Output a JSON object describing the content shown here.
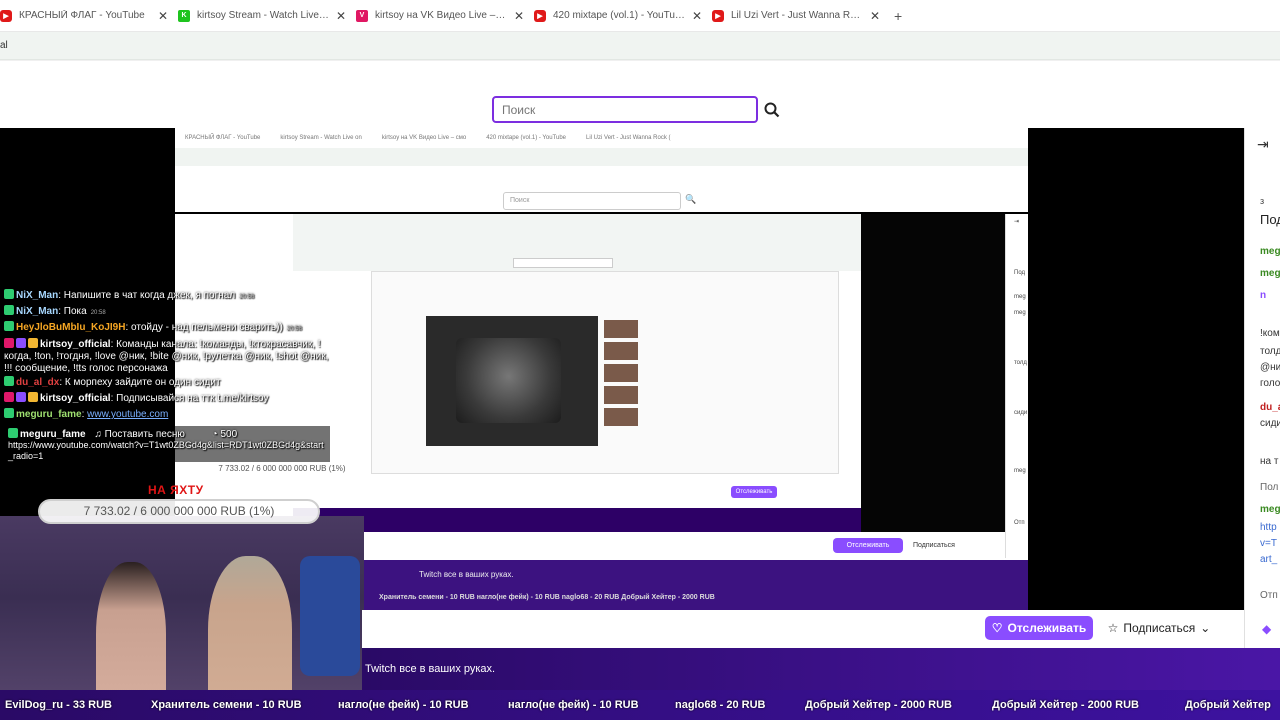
{
  "tabs": [
    {
      "title": "КРАСНЫЙ ФЛАГ - YouTube",
      "favicon": "youtube-icon"
    },
    {
      "title": "kirtsoy Stream - Watch Live on",
      "favicon": "twitch-k-icon"
    },
    {
      "title": "kirtsoy на VK Видео Live – смо",
      "favicon": "vk-video-icon"
    },
    {
      "title": "420 mixtape (vol.1) - YouTube",
      "favicon": "youtube-icon"
    },
    {
      "title": "Lil Uzi Vert - Just Wanna Rock (",
      "favicon": "youtube-icon"
    }
  ],
  "search": {
    "placeholder": "Поиск"
  },
  "nested": {
    "tabs": [
      "КРАСНЫЙ ФЛАГ - YouTube",
      "kirtsoy Stream - Watch Live on",
      "kirtsoy на VK Видео Live – смо",
      "420 mixtape (vol.1) - YouTube",
      "Lil Uzi Vert - Just Wanna Rock ("
    ],
    "search_placeholder": "Поиск",
    "follow_label": "Отслеживать",
    "subscribe_label": "Подписаться",
    "banner_text": "Twitch все в ваших руках.",
    "ticker_text": "Хранитель семени - 10 RUB      нагло(не фейк) - 10 RUB      naglo68 - 20 RUB      Добрый Хейтер - 2000 RUB",
    "inner_follow": "Отслеживать"
  },
  "chat": [
    {
      "name": "NiX_Man",
      "text": "Напишите в чат когда джек, я погнал",
      "time": "20:58",
      "color": "#a8d8ff"
    },
    {
      "name": "NiX_Man",
      "text": "Пока",
      "time": "20:58",
      "color": "#a8d8ff"
    },
    {
      "name": "HeyJloBuMbIu_KoJI9H",
      "text": "отойду - над пельмени сварить))",
      "time": "20:58",
      "color": "#f5a623"
    },
    {
      "name": "kirtsoy_official",
      "text": "Команды канала: !команды, !ктокрасавчик, !когда, !ton, !тогдня, !love @ник, !bite @ник, !рулетка @ник, !shot @ник, !!! сообщение, !tts голос персонажа",
      "time": "",
      "color": "#ffffff"
    },
    {
      "name": "du_al_dx",
      "text": "К морпеху зайдите он один сидит",
      "time": "",
      "color": "#e04040"
    },
    {
      "name": "kirtsoy_official",
      "text": "Подписывайся на ттк t.me/kirtsoy",
      "time": "",
      "color": "#ffffff"
    },
    {
      "name": "meguru_fame",
      "text": "www.youtube.com",
      "time": "",
      "color": "#9fe070"
    },
    {
      "name": "meguru_fame",
      "text": "Поставить песню",
      "time": "",
      "color": "#ffffff"
    }
  ],
  "tts": {
    "points": "500",
    "url": "https://www.youtube.com/watch?v=T1wt0ZBGd4g&list=RDT1wt0ZBGd4g&start_radio=1",
    "small_goal": "7 733.02 / 6 000 000 000 RUB (1%)"
  },
  "goal": {
    "title": "НА ЯХТУ",
    "text": "7 733.02 / 6 000 000 000 RUB (1%)",
    "progress": 0.01
  },
  "channel": {
    "follow_label": "Отслеживать",
    "subscribe_label": "Подписаться",
    "banner_text": "Twitch все в ваших руках."
  },
  "ticker": [
    "EvilDog_ru - 33 RUB",
    "Хранитель семени - 10 RUB",
    "нагло(не фейк) - 10 RUB",
    "нагло(не фейк) - 10 RUB",
    "naglo68 - 20 RUB",
    "Добрый Хейтер - 2000 RUB",
    "Добрый Хейтер - 2000 RUB",
    "Добрый Хейтер"
  ],
  "right_panel": [
    "з",
    "Под",
    "meg",
    "meg",
    "n",
    "!ком",
    "толд",
    "@ни",
    "голо",
    "du_a",
    "сиди",
    "на т",
    "Пол",
    "meg",
    "http",
    "v=T",
    "art_",
    "Отп"
  ],
  "colors": {
    "accent": "#8a4dff",
    "search_border": "#7c2ee0",
    "banner": "#3c1280"
  }
}
